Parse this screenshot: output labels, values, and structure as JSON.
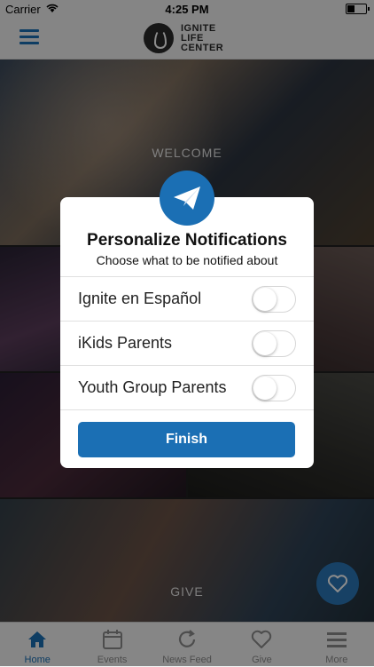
{
  "status_bar": {
    "carrier": "Carrier",
    "time": "4:25 PM"
  },
  "header": {
    "logo_text": [
      "IGNITE",
      "LIFE",
      "CENTER"
    ]
  },
  "tiles": [
    {
      "label": "WELCOME"
    },
    {
      "label": "GIVE"
    }
  ],
  "modal": {
    "title": "Personalize Notifications",
    "subtitle": "Choose what to be notified about",
    "options": [
      {
        "label": "Ignite en Español",
        "enabled": false
      },
      {
        "label": "iKids Parents",
        "enabled": false
      },
      {
        "label": "Youth Group Parents",
        "enabled": false
      }
    ],
    "finish_label": "Finish"
  },
  "tabs": [
    {
      "label": "Home",
      "icon": "home-icon",
      "active": true
    },
    {
      "label": "Events",
      "icon": "calendar-icon",
      "active": false
    },
    {
      "label": "News Feed",
      "icon": "refresh-icon",
      "active": false
    },
    {
      "label": "Give",
      "icon": "heart-icon",
      "active": false
    },
    {
      "label": "More",
      "icon": "menu-icon",
      "active": false
    }
  ],
  "colors": {
    "accent": "#1b6fb4",
    "tab_inactive": "#8c8c8c"
  }
}
